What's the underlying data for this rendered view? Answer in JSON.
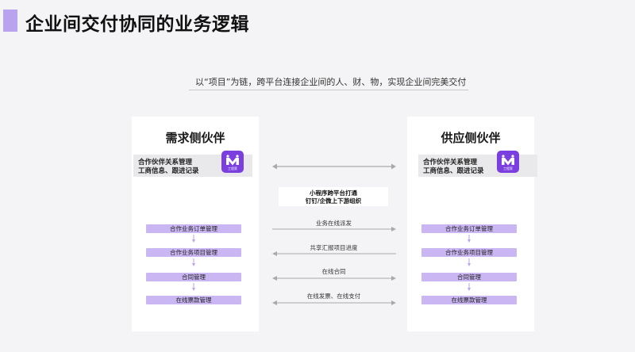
{
  "title": "企业间交付协同的业务逻辑",
  "subtitle": "以“项目”为链，跨平台连接企业间的人、财、物，实现企业间完美交付",
  "left_panel": {
    "title": "需求侧伙伴",
    "info_line1": "合作伙伴关系管理",
    "info_line2": "工商信息、跟进记录",
    "app_label": "工程家",
    "steps": [
      "合作业务订单管理",
      "合作业务项目管理",
      "合同管理",
      "在线票款管理"
    ]
  },
  "right_panel": {
    "title": "供应侧伙伴",
    "info_line1": "合作伙伴关系管理",
    "info_line2": "工商信息、跟进记录",
    "app_label": "工程家",
    "steps": [
      "合作业务订单管理",
      "合作业务项目管理",
      "合同管理",
      "在线票款管理"
    ]
  },
  "center_box": {
    "line1": "小程序跨平台打通",
    "line2": "钉钉/企微上下游组织"
  },
  "flows": [
    "业务在线派发",
    "共享汇报项目进度",
    "在线合同",
    "在线发票、在线支付"
  ],
  "colors": {
    "accent": "#b9a2ee",
    "step_fill": "#c9b6f2",
    "app_icon": "#7b3fe0",
    "arrow": "#a9a9a9"
  }
}
